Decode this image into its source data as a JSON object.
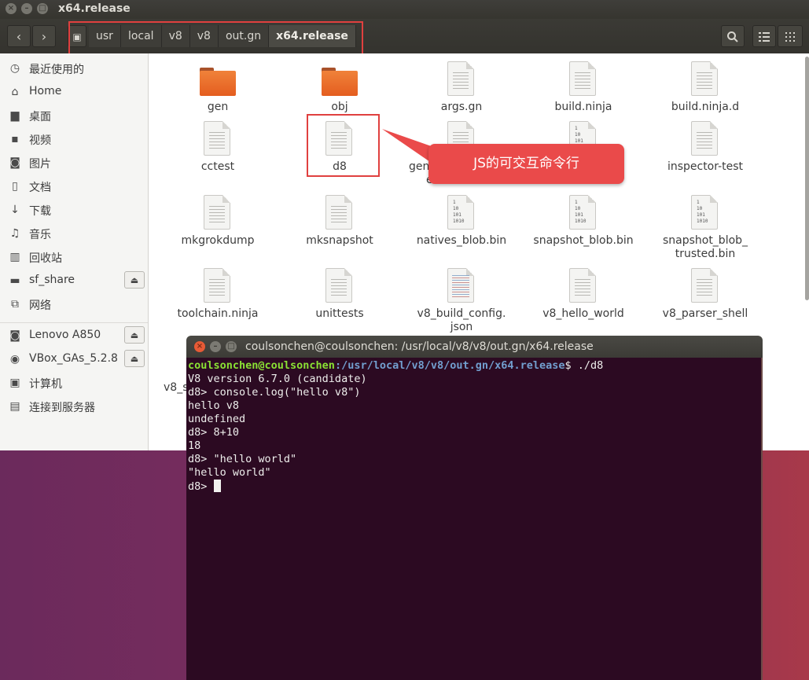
{
  "window": {
    "title": "x64.release"
  },
  "toolbar": {
    "back": "‹",
    "forward": "›",
    "crumbs": [
      "usr",
      "local",
      "v8",
      "v8",
      "out.gn",
      "x64.release"
    ],
    "search_icon": "search-icon",
    "list_icon": "list-view-icon",
    "grid_icon": "grid-view-icon"
  },
  "sidebar": {
    "items": [
      {
        "label": "最近使用的",
        "icon": "clock-icon"
      },
      {
        "label": "Home",
        "icon": "home-icon"
      },
      {
        "label": "桌面",
        "icon": "desktop-folder-icon"
      },
      {
        "label": "视频",
        "icon": "video-icon"
      },
      {
        "label": "图片",
        "icon": "camera-icon"
      },
      {
        "label": "文档",
        "icon": "document-icon"
      },
      {
        "label": "下载",
        "icon": "download-icon"
      },
      {
        "label": "音乐",
        "icon": "music-icon"
      },
      {
        "label": "回收站",
        "icon": "trash-icon"
      },
      {
        "label": "sf_share",
        "icon": "drive-icon"
      },
      {
        "label": "网络",
        "icon": "network-icon"
      },
      {
        "label": "Lenovo A850",
        "icon": "camera-device-icon"
      },
      {
        "label": "VBox_GAs_5.2.8",
        "icon": "disc-icon"
      },
      {
        "label": "计算机",
        "icon": "computer-icon"
      },
      {
        "label": "连接到服务器",
        "icon": "server-icon"
      }
    ]
  },
  "files": [
    {
      "name": "gen",
      "type": "folder"
    },
    {
      "name": "obj",
      "type": "folder"
    },
    {
      "name": "args.gn",
      "type": "text"
    },
    {
      "name": "build.ninja",
      "type": "text"
    },
    {
      "name": "build.ninja.d",
      "type": "text"
    },
    {
      "name": "cctest",
      "type": "text"
    },
    {
      "name": "d8",
      "type": "text"
    },
    {
      "name": "gen",
      "type": "text"
    },
    {
      "name": "",
      "type": "binary"
    },
    {
      "name": "inspector-test",
      "type": "text"
    },
    {
      "name": "mkgrokdump",
      "type": "text"
    },
    {
      "name": "mksnapshot",
      "type": "text"
    },
    {
      "name": "natives_blob.bin",
      "type": "binary"
    },
    {
      "name": "snapshot_blob.bin",
      "type": "binary"
    },
    {
      "name": "snapshot_blob_\ntrusted.bin",
      "type": "binary"
    },
    {
      "name": "toolchain.ninja",
      "type": "text"
    },
    {
      "name": "unittests",
      "type": "text"
    },
    {
      "name": "v8_build_config.\njson",
      "type": "code"
    },
    {
      "name": "v8_hello_world",
      "type": "text"
    },
    {
      "name": "v8_parser_shell",
      "type": "text"
    }
  ],
  "partial_labels": {
    "gen_suffix": "e",
    "behind_terminal": "v8_s"
  },
  "callout": {
    "text": "JS的可交互命令行"
  },
  "terminal": {
    "title": "coulsonchen@coulsonchen: /usr/local/v8/v8/out.gn/x64.release",
    "prompt_user": "coulsonchen@coulsonchen",
    "prompt_path": ":/usr/local/v8/v8/out.gn/x64.release",
    "prompt_cmd": "$ ./d8",
    "lines": [
      "V8 version 6.7.0 (candidate)",
      "d8> console.log(\"hello v8\")",
      "hello v8",
      "undefined",
      "d8> 8+10",
      "18",
      "d8> \"hello world\"",
      "\"hello world\""
    ],
    "last_prompt": "d8> "
  },
  "colors": {
    "accent": "#e45d1f",
    "highlight": "#e0403f",
    "terminal_bg": "#2c0a22"
  }
}
